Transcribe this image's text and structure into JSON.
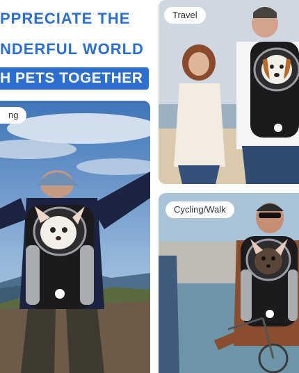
{
  "headline": {
    "line1": "PPRECIATE THE",
    "line2": "NDERFUL WORLD",
    "banner": "H PETS TOGETHER"
  },
  "panels": {
    "left": {
      "tag": "ng"
    },
    "travel": {
      "tag": "Travel"
    },
    "cycling": {
      "tag": "Cycling/Walk"
    }
  },
  "colors": {
    "brand_blue": "#2d6fcf",
    "backpack_black": "#1b1b1d",
    "backpack_grey": "#a9adb1"
  },
  "icons": [
    "backpack-illustration",
    "dog-illustration"
  ]
}
